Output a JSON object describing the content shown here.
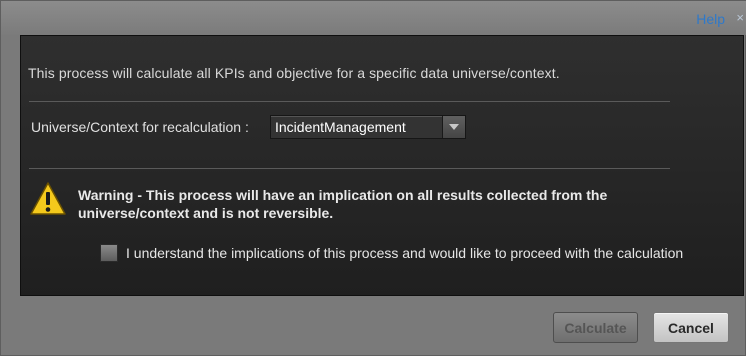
{
  "header": {
    "help_label": "Help",
    "close_glyph": "×"
  },
  "dialog": {
    "intro_text": "This process will calculate all KPIs and objective for a specific data universe/context.",
    "universe_label": "Universe/Context for recalculation :",
    "universe_select": {
      "value": "IncidentManagement"
    },
    "warning_text": "Warning - This process will have an implication on all results collected from the universe/context and is not reversible.",
    "confirm_checkbox": {
      "label": "I understand the implications of this process and would like to proceed with the calculation",
      "checked": false
    }
  },
  "footer": {
    "calculate_label": "Calculate",
    "calculate_enabled": false,
    "cancel_label": "Cancel"
  },
  "icons": {
    "warning": "warning-triangle-icon",
    "dropdown": "chevron-down-icon",
    "close": "close-icon"
  },
  "colors": {
    "help_link": "#2f79c9",
    "panel_bg": "#262626",
    "warning_yellow": "#f4c91c"
  }
}
